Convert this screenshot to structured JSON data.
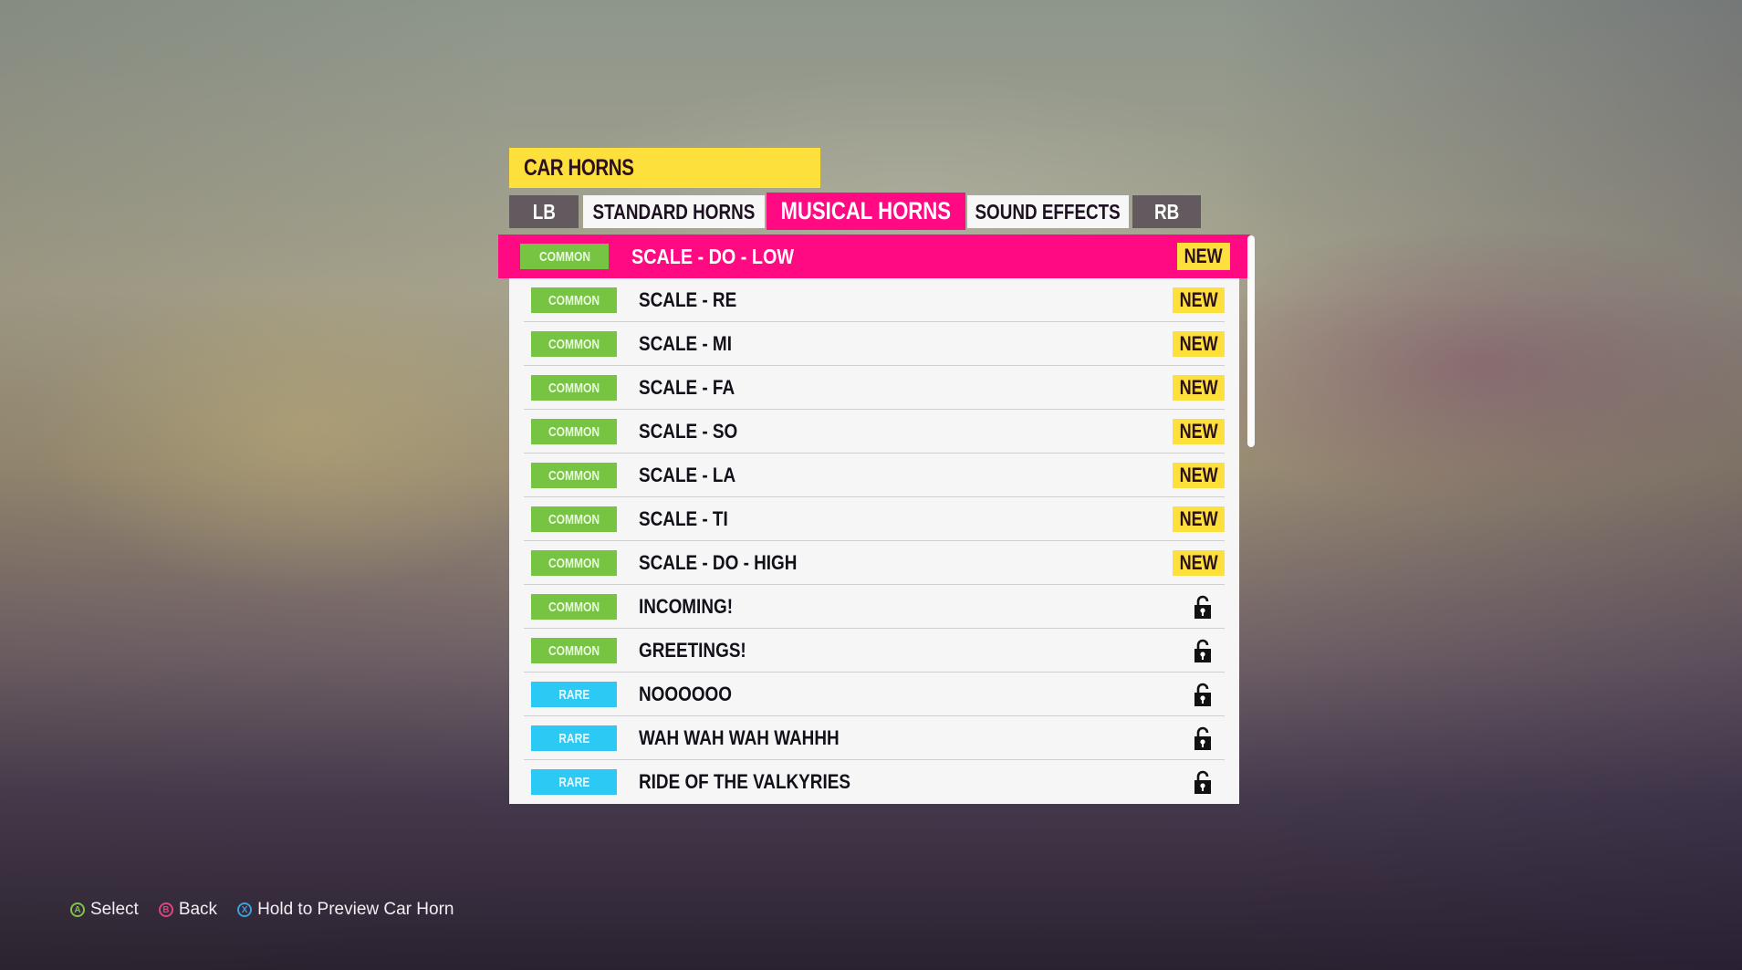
{
  "header": {
    "title": "CAR HORNS"
  },
  "tabs": {
    "left_bumper": "LB",
    "right_bumper": "RB",
    "items": [
      {
        "label": "STANDARD HORNS",
        "active": false
      },
      {
        "label": "MUSICAL HORNS",
        "active": true
      },
      {
        "label": "SOUND EFFECTS",
        "active": false
      }
    ]
  },
  "colors": {
    "accent_pink": "#FF0A82",
    "title_yellow": "#FDE03C",
    "common_green": "#77C442",
    "rare_cyan": "#2CC9F4"
  },
  "list": {
    "selected_index": 0,
    "items": [
      {
        "rarity": "COMMON",
        "name": "SCALE - DO - LOW",
        "status": "NEW"
      },
      {
        "rarity": "COMMON",
        "name": "SCALE - RE",
        "status": "NEW"
      },
      {
        "rarity": "COMMON",
        "name": "SCALE - MI",
        "status": "NEW"
      },
      {
        "rarity": "COMMON",
        "name": "SCALE - FA",
        "status": "NEW"
      },
      {
        "rarity": "COMMON",
        "name": "SCALE - SO",
        "status": "NEW"
      },
      {
        "rarity": "COMMON",
        "name": "SCALE - LA",
        "status": "NEW"
      },
      {
        "rarity": "COMMON",
        "name": "SCALE - TI",
        "status": "NEW"
      },
      {
        "rarity": "COMMON",
        "name": "SCALE - DO - HIGH",
        "status": "NEW"
      },
      {
        "rarity": "COMMON",
        "name": "INCOMING!",
        "status": "unlocked-icon"
      },
      {
        "rarity": "COMMON",
        "name": "GREETINGS!",
        "status": "unlocked-icon"
      },
      {
        "rarity": "RARE",
        "name": "NOOOOOO",
        "status": "unlocked-icon"
      },
      {
        "rarity": "RARE",
        "name": "WAH WAH WAH WAHHH",
        "status": "unlocked-icon"
      },
      {
        "rarity": "RARE",
        "name": "RIDE OF THE VALKYRIES",
        "status": "unlocked-icon"
      }
    ]
  },
  "footer": {
    "hints": [
      {
        "button": "A",
        "label": "Select"
      },
      {
        "button": "B",
        "label": "Back"
      },
      {
        "button": "X",
        "label": "Hold to Preview Car Horn"
      }
    ]
  }
}
